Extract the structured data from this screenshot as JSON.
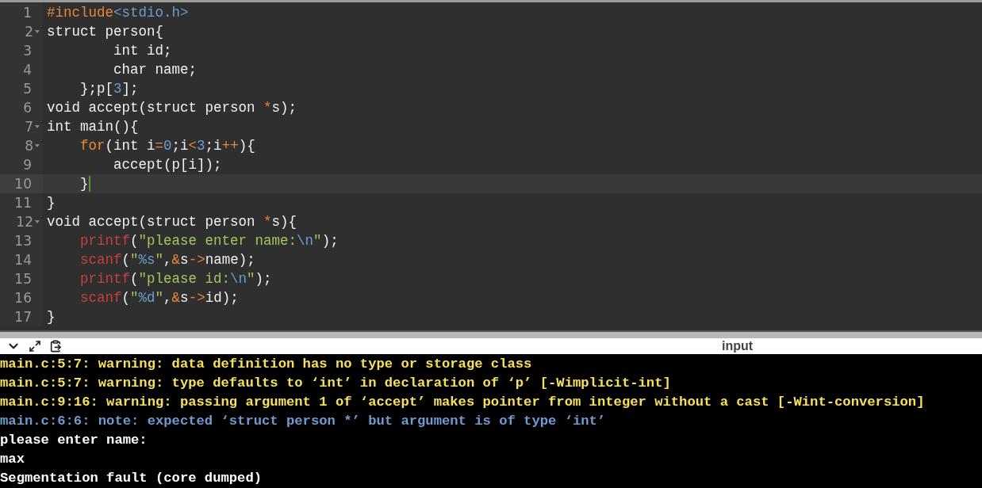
{
  "editor": {
    "lines": [
      {
        "number": "1",
        "foldable": false,
        "current": false,
        "tokens": [
          {
            "kind": "keyword",
            "text": "#include"
          },
          {
            "kind": "literal",
            "text": "<stdio.h>"
          }
        ]
      },
      {
        "number": "2",
        "foldable": true,
        "current": false,
        "tokens": [
          {
            "kind": "plain",
            "text": "struct person{"
          }
        ]
      },
      {
        "number": "3",
        "foldable": false,
        "current": false,
        "tokens": [
          {
            "kind": "plain",
            "text": "        int id;"
          }
        ]
      },
      {
        "number": "4",
        "foldable": false,
        "current": false,
        "tokens": [
          {
            "kind": "plain",
            "text": "        char name;"
          }
        ]
      },
      {
        "number": "5",
        "foldable": false,
        "current": false,
        "tokens": [
          {
            "kind": "plain",
            "text": "    };p["
          },
          {
            "kind": "literal",
            "text": "3"
          },
          {
            "kind": "plain",
            "text": "];"
          }
        ]
      },
      {
        "number": "6",
        "foldable": false,
        "current": false,
        "tokens": [
          {
            "kind": "plain",
            "text": "void accept(struct person "
          },
          {
            "kind": "operator",
            "text": "*"
          },
          {
            "kind": "plain",
            "text": "s);"
          }
        ]
      },
      {
        "number": "7",
        "foldable": true,
        "current": false,
        "tokens": [
          {
            "kind": "plain",
            "text": "int main(){"
          }
        ]
      },
      {
        "number": "8",
        "foldable": true,
        "current": false,
        "tokens": [
          {
            "kind": "keyword",
            "text": "    for"
          },
          {
            "kind": "plain",
            "text": "(int i"
          },
          {
            "kind": "operator",
            "text": "="
          },
          {
            "kind": "literal",
            "text": "0"
          },
          {
            "kind": "plain",
            "text": ";i"
          },
          {
            "kind": "operator",
            "text": "<"
          },
          {
            "kind": "literal",
            "text": "3"
          },
          {
            "kind": "plain",
            "text": ";i"
          },
          {
            "kind": "operator",
            "text": "++"
          },
          {
            "kind": "plain",
            "text": "){"
          }
        ]
      },
      {
        "number": "9",
        "foldable": false,
        "current": false,
        "tokens": [
          {
            "kind": "plain",
            "text": "        accept(p[i]);"
          }
        ]
      },
      {
        "number": "10",
        "foldable": false,
        "current": true,
        "tokens": [
          {
            "kind": "plain",
            "text": "    }"
          }
        ]
      },
      {
        "number": "11",
        "foldable": false,
        "current": false,
        "tokens": [
          {
            "kind": "plain",
            "text": "}"
          }
        ]
      },
      {
        "number": "12",
        "foldable": true,
        "current": false,
        "tokens": [
          {
            "kind": "plain",
            "text": "void accept(struct person "
          },
          {
            "kind": "operator",
            "text": "*"
          },
          {
            "kind": "plain",
            "text": "s){"
          }
        ]
      },
      {
        "number": "13",
        "foldable": false,
        "current": false,
        "tokens": [
          {
            "kind": "function",
            "text": "    printf"
          },
          {
            "kind": "plain",
            "text": "("
          },
          {
            "kind": "string",
            "text": "\"please enter name:"
          },
          {
            "kind": "literal",
            "text": "\\n"
          },
          {
            "kind": "string",
            "text": "\""
          },
          {
            "kind": "plain",
            "text": ");"
          }
        ]
      },
      {
        "number": "14",
        "foldable": false,
        "current": false,
        "tokens": [
          {
            "kind": "function",
            "text": "    scanf"
          },
          {
            "kind": "plain",
            "text": "("
          },
          {
            "kind": "string",
            "text": "\""
          },
          {
            "kind": "literal",
            "text": "%s"
          },
          {
            "kind": "string",
            "text": "\""
          },
          {
            "kind": "plain",
            "text": ","
          },
          {
            "kind": "operator",
            "text": "&"
          },
          {
            "kind": "plain",
            "text": "s"
          },
          {
            "kind": "operator",
            "text": "->"
          },
          {
            "kind": "plain",
            "text": "name);"
          }
        ]
      },
      {
        "number": "15",
        "foldable": false,
        "current": false,
        "tokens": [
          {
            "kind": "function",
            "text": "    printf"
          },
          {
            "kind": "plain",
            "text": "("
          },
          {
            "kind": "string",
            "text": "\"please id:"
          },
          {
            "kind": "literal",
            "text": "\\n"
          },
          {
            "kind": "string",
            "text": "\""
          },
          {
            "kind": "plain",
            "text": ");"
          }
        ]
      },
      {
        "number": "16",
        "foldable": false,
        "current": false,
        "tokens": [
          {
            "kind": "function",
            "text": "    scanf"
          },
          {
            "kind": "plain",
            "text": "("
          },
          {
            "kind": "string",
            "text": "\""
          },
          {
            "kind": "literal",
            "text": "%d"
          },
          {
            "kind": "string",
            "text": "\""
          },
          {
            "kind": "plain",
            "text": ","
          },
          {
            "kind": "operator",
            "text": "&"
          },
          {
            "kind": "plain",
            "text": "s"
          },
          {
            "kind": "operator",
            "text": "->"
          },
          {
            "kind": "plain",
            "text": "id);"
          }
        ]
      },
      {
        "number": "17",
        "foldable": false,
        "current": false,
        "tokens": [
          {
            "kind": "plain",
            "text": "}"
          }
        ]
      }
    ]
  },
  "console": {
    "title": "input",
    "lines": [
      {
        "kind": "warning",
        "text": "main.c:5:7: warning: data definition has no type or storage class"
      },
      {
        "kind": "warning",
        "text": "main.c:5:7: warning: type defaults to ‘int’ in declaration of ‘p’ [-Wimplicit-int]"
      },
      {
        "kind": "warning",
        "text": "main.c:9:16: warning: passing argument 1 of ‘accept’ makes pointer from integer without a cast [-Wint-conversion]"
      },
      {
        "kind": "note",
        "text": "main.c:6:6: note: expected ‘struct person *’ but argument is of type ‘int’"
      },
      {
        "kind": "output",
        "text": "please enter name:"
      },
      {
        "kind": "output",
        "text": "max"
      },
      {
        "kind": "output",
        "text": "Segmentation fault (core dumped)"
      }
    ]
  }
}
